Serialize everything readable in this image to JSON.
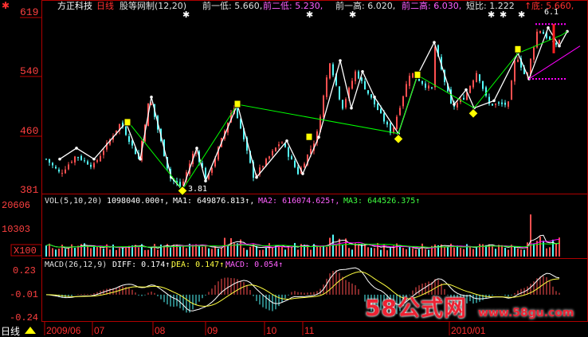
{
  "header": {
    "icon": "gear-icon",
    "stock_name": "方正科技",
    "period": "日线",
    "indicator": "股等网制(12,20)",
    "items": [
      "前一低: 5.660,",
      "前二低: 5.230,",
      "前一高: 6.020,",
      "前二高: 6.030,",
      "短比: 1.222",
      "↑",
      "底: 5.660,"
    ]
  },
  "price_axis": {
    "ticks": [
      "619",
      "540",
      "460",
      "381"
    ],
    "ticks_values": [
      6.19,
      5.4,
      4.6,
      3.81
    ],
    "low_label": "3.81",
    "high_label": "6.1"
  },
  "volume_panel": {
    "header": [
      "VOL(5,10,20)",
      "1098040.000↑,",
      "MA1: 649876.813↑,",
      "MA2: 616074.625↑,",
      "MA3: 644526.375↑"
    ],
    "ticks": [
      "20606",
      "10303"
    ],
    "ticks_values": [
      20606,
      10303
    ],
    "multiplier": "X100"
  },
  "macd_panel": {
    "header": [
      "MACD(26,12,9)",
      "DIFF: 0.174↑,",
      "DEA: 0.147↑,",
      "MACD: 0.054↑"
    ],
    "ticks": [
      "0.23",
      "-0.01",
      "-0.24"
    ],
    "ticks_values": [
      0.23,
      -0.01,
      -0.24
    ]
  },
  "date_axis": {
    "period_tab": "日线",
    "labels": [
      "2009/06",
      "07",
      "08",
      "09",
      "10",
      "11",
      "2010/01"
    ]
  },
  "watermark": {
    "text": "58公式网",
    "url": "www.58gu.com"
  },
  "colors": {
    "background": "#000000",
    "up": "#ff5050",
    "down": "#54fcfc",
    "axis": "#c80000",
    "ma1": "#ffffff",
    "ma2": "#ff00ff",
    "ma3": "#00ff00",
    "zigzag": "#ffffff",
    "trend": "#00ff00",
    "channel": "#ff00ff",
    "marker": "#ffff00",
    "header_text": "#c0c0c0"
  }
}
